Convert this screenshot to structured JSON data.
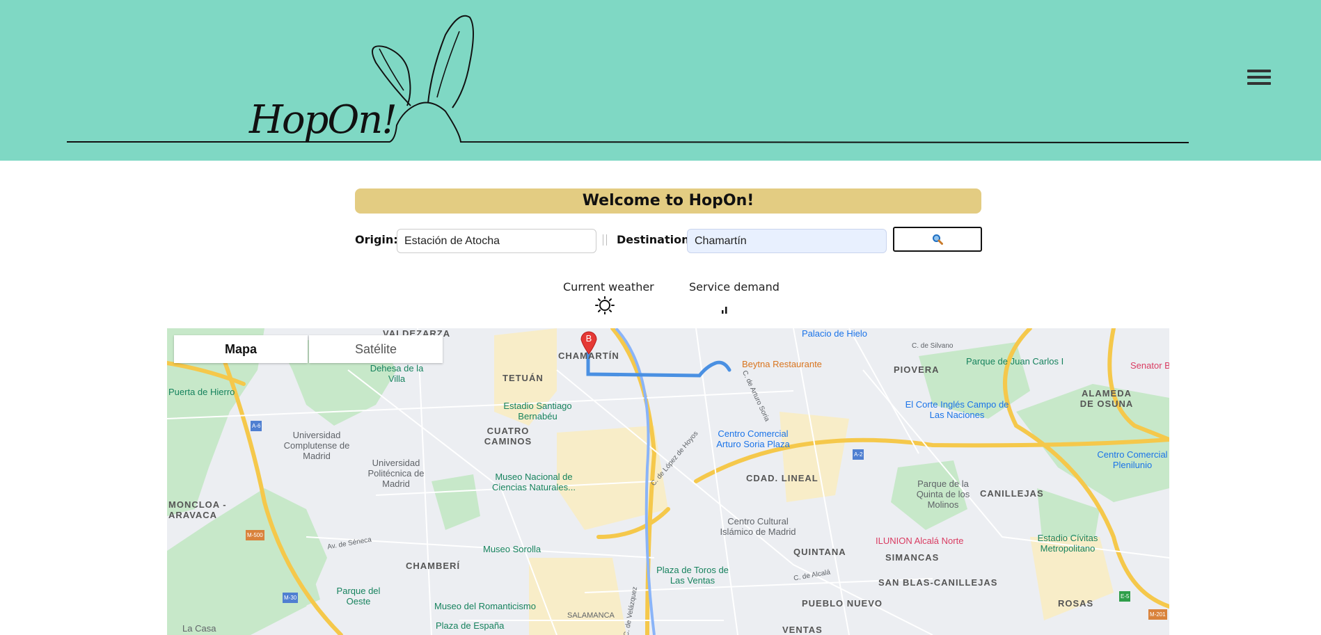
{
  "header": {
    "logo_text": "HopOn!",
    "menu_icon": "hamburger-menu-icon"
  },
  "banner": {
    "title": "Welcome to HopOn!"
  },
  "form": {
    "origin_label": "Origin:",
    "origin_value": "Estación de Atocha",
    "destination_label": "Destination:",
    "destination_value": "Chamartín",
    "search_icon": "search-icon"
  },
  "info": {
    "weather_label": "Current weather",
    "weather_icon": "sun-icon",
    "demand_label": "Service demand",
    "demand_icon": "signal-bars-icon"
  },
  "map": {
    "tabs": [
      {
        "label": "Mapa"
      },
      {
        "label": "Satélite"
      }
    ],
    "marker_label": "B",
    "districts": [
      "VALDEZARZA",
      "CHAMARTÍN",
      "TETUÁN",
      "PIOVERA",
      "ALAMEDA DE OSUNA",
      "CUATRO CAMINOS",
      "CDAD. LINEAL",
      "MONCLOA - ARAVACA",
      "CANILLEJAS",
      "QUINTANA",
      "SIMANCAS",
      "CHAMBERÍ",
      "SAN BLAS-CANILLEJAS",
      "PUEBLO NUEVO",
      "ROSAS",
      "SALAMANCA",
      "VENTAS"
    ],
    "places": [
      "Palacio de Hielo",
      "Beytna Restaurante",
      "Parque de Juan Carlos I",
      "Senator B",
      "Dehesa de la Villa",
      "Puerta de Hierro",
      "Estadio Santiago Bernabéu",
      "El Corte Inglés Campo de Las Naciones",
      "Universidad Complutense de Madrid",
      "Centro Comercial Arturo Soria Plaza",
      "Universidad Politécnica de Madrid",
      "Centro Comercial Plenilunio",
      "Museo Nacional de Ciencias Naturales...",
      "Parque de la Quinta de los Molinos",
      "Centro Cultural Islámico de Madrid",
      "ILUNION Alcalá Norte",
      "Estadio Cívitas Metropolitano",
      "Museo Sorolla",
      "Plaza de Toros de Las Ventas",
      "Parque del Oeste",
      "Museo del Romanticismo",
      "Plaza de España",
      "La Casa",
      "C. de Silvano",
      "Av. de Séneca",
      "C. de Alcalá",
      "C. de López de Hoyos",
      "C. de Velázquez",
      "C. de Arturo Soria"
    ],
    "road_shields": [
      "A-6",
      "M-500",
      "M-30",
      "A-2",
      "E-5",
      "M-201"
    ]
  },
  "colors": {
    "header_bg": "#7fd8c4",
    "banner_bg": "#e3cc82",
    "route": "#4a90e2",
    "marker": "#e53935"
  }
}
